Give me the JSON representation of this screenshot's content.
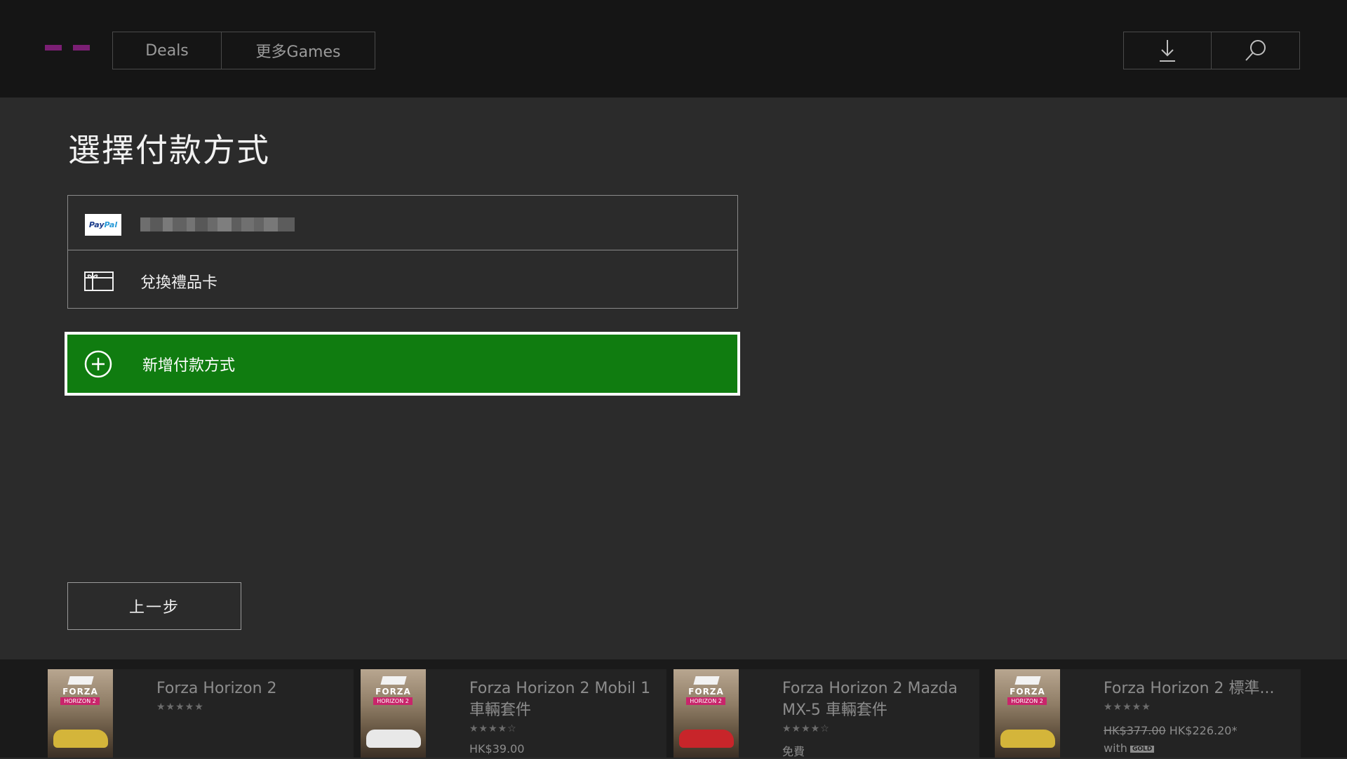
{
  "nav": {
    "tabs": [
      "Deals",
      "更多Games"
    ],
    "icons": [
      "download-icon",
      "search-icon"
    ]
  },
  "page": {
    "title": "選擇付款方式"
  },
  "payment_methods": {
    "paypal_logo_text": "PayPal",
    "paypal_account": "",
    "gift_card_label": "兌換禮品卡"
  },
  "add_payment": {
    "label": "新增付款方式"
  },
  "back_button": {
    "label": "上一步"
  },
  "colors": {
    "accent_green": "#107c10",
    "logo_purple": "#7b1f74",
    "background": "#2b2b2b",
    "topbar": "#151515"
  },
  "related": [
    {
      "cover_title": "FORZA",
      "cover_subtitle": "HORIZON 2",
      "name": "Forza Horizon 2",
      "rating_text": "★★★★★",
      "price": "",
      "original_price": "",
      "sale_price": "",
      "gold_text": ""
    },
    {
      "cover_title": "FORZA",
      "cover_subtitle": "HORIZON 2",
      "name": "Forza Horizon 2 Mobil 1 車輛套件",
      "rating_text": "★★★★☆",
      "price": "HK$39.00",
      "original_price": "",
      "sale_price": "",
      "gold_text": ""
    },
    {
      "cover_title": "FORZA",
      "cover_subtitle": "HORIZON 2",
      "name": "Forza Horizon 2 Mazda MX-5 車輛套件",
      "rating_text": "★★★★☆",
      "price": "免費",
      "original_price": "",
      "sale_price": "",
      "gold_text": ""
    },
    {
      "cover_title": "FORZA",
      "cover_subtitle": "HORIZON 2",
      "name": "Forza Horizon 2 標準...",
      "rating_text": "★★★★★",
      "price": "",
      "original_price": "HK$377.00",
      "sale_price": "HK$226.20*",
      "gold_text": "with",
      "gold_badge": "GOLD"
    }
  ]
}
